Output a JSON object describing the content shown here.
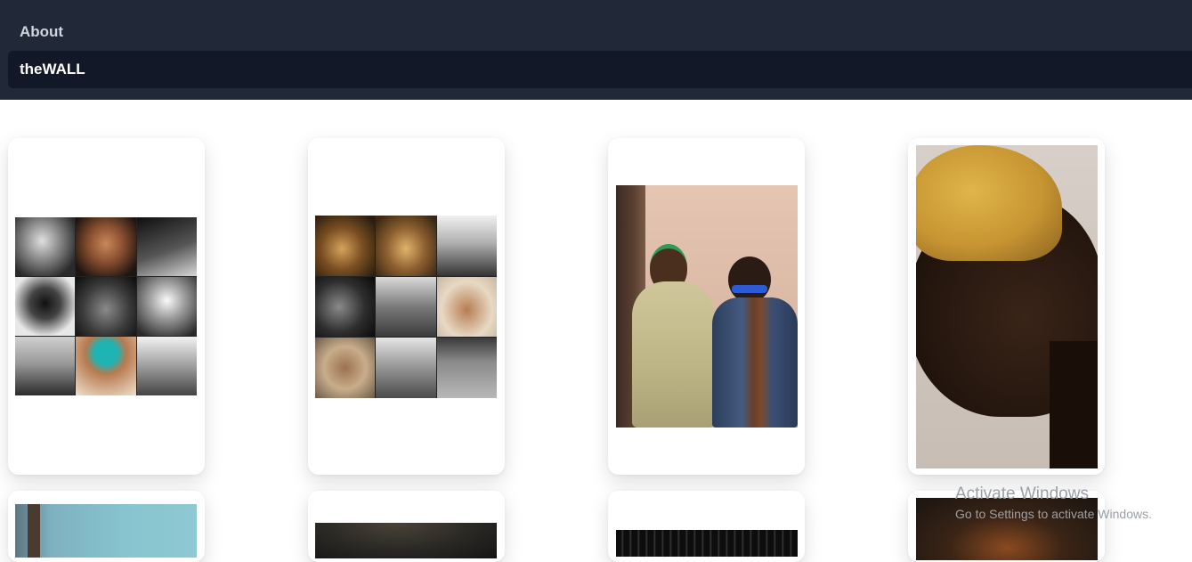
{
  "nav": {
    "about_label": "About",
    "wall_label": "theWALL"
  },
  "gallery": {
    "cards": [
      {
        "description": "collage-grayscale-3x3"
      },
      {
        "description": "collage-sepia-3x3"
      },
      {
        "description": "two-men-photo"
      },
      {
        "description": "blond-hair-portrait"
      }
    ]
  },
  "watermark": {
    "line1": "Activate Windows",
    "line2": "Go to Settings to activate Windows."
  },
  "colors": {
    "header_bg": "#212838",
    "active_item_bg": "#121827",
    "page_bg": "#ffffff"
  }
}
